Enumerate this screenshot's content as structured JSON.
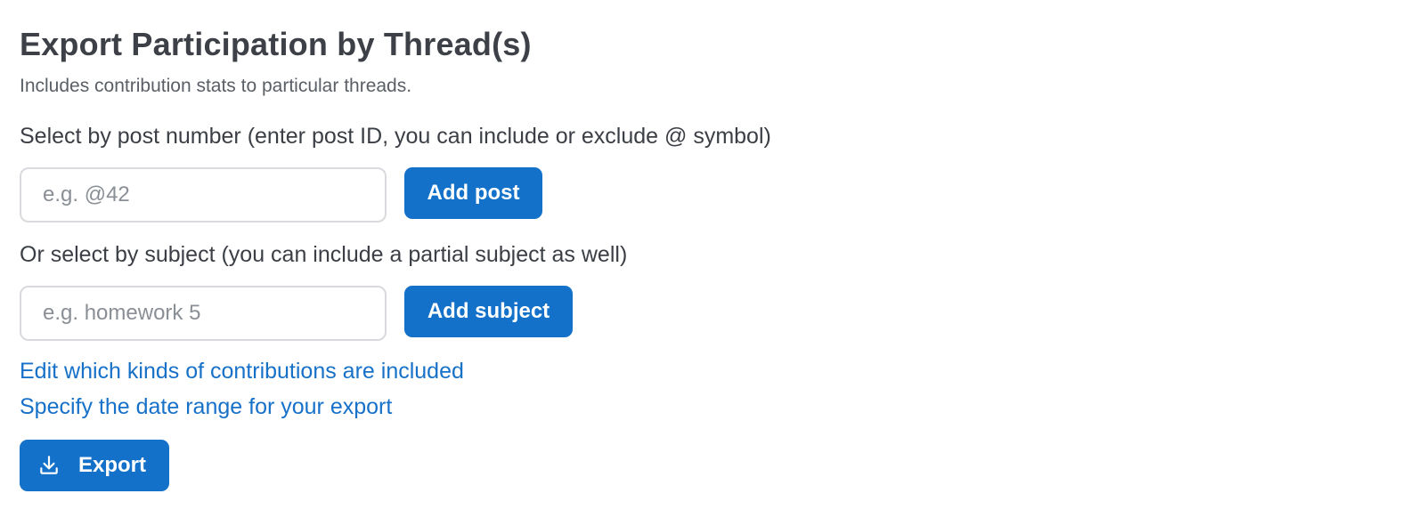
{
  "header": {
    "title": "Export Participation by Thread(s)",
    "subtitle": "Includes contribution stats to particular threads."
  },
  "post_section": {
    "label": "Select by post number (enter post ID, you can include or exclude @ symbol)",
    "input_placeholder": "e.g. @42",
    "input_value": "",
    "button_label": "Add post"
  },
  "subject_section": {
    "label": "Or select by subject (you can include a partial subject as well)",
    "input_placeholder": "e.g. homework 5",
    "input_value": "",
    "button_label": "Add subject"
  },
  "links": {
    "contributions": "Edit which kinds of contributions are included",
    "date_range": "Specify the date range for your export"
  },
  "export": {
    "label": "Export",
    "icon": "download-icon"
  },
  "colors": {
    "accent": "#1371c9",
    "link": "#1771c8",
    "text": "#3b3f45",
    "border": "#d8dade"
  }
}
